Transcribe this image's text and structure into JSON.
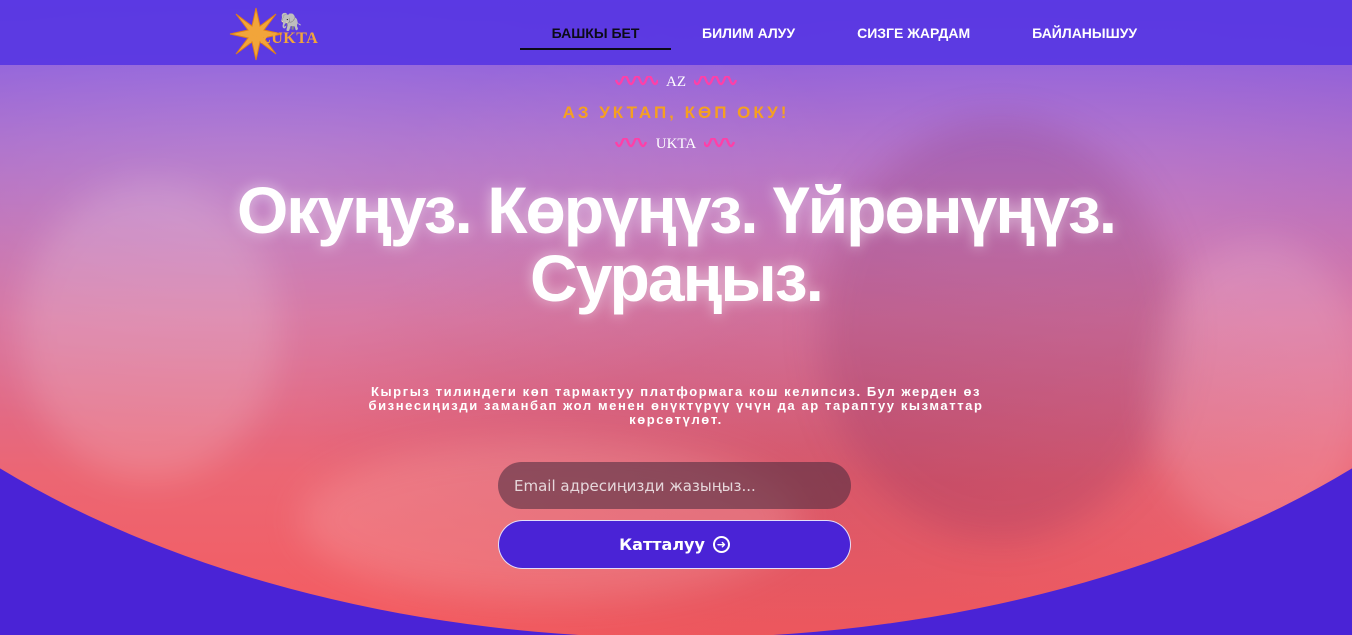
{
  "header": {
    "logo": {
      "brand_text": "AZUKTA",
      "icon": "sun-elephant-logo"
    },
    "nav": [
      {
        "label": "БАШКЫ БЕТ",
        "active": true
      },
      {
        "label": "БИЛИМ АЛУУ",
        "active": false
      },
      {
        "label": "СИЗГЕ ЖАРДАМ",
        "active": false
      },
      {
        "label": "БАЙЛАНЫШУУ",
        "active": false
      }
    ]
  },
  "hero": {
    "tag_top": "AZ",
    "tagline": "АЗ УКТАП, КӨП ОКУ!",
    "tag_bottom": "UKTA",
    "headline": "Окуңуз. Көрүңүз. Үйрөнүңүз. Сураңыз.",
    "subtext": "Кыргыз тилиндеги көп тармактуу платформага кош келипсиз.  Бул жерден өз бизнесиңизди заманбап жол менен өнүктүрүү үчүн да ар тараптуу кызматтар көрсөтүлөт.",
    "email_placeholder": "Email адресиңизди жазыңыз...",
    "signup_label": "Катталуу",
    "signup_icon": "arrow-circle-right-icon",
    "squiggle_icon": "wave-squiggle-icon"
  },
  "colors": {
    "brand_purple": "#4a23d6",
    "header_purple": "#5837e2",
    "accent_orange": "#f5a021",
    "squiggle_pink": "#ff3fa8",
    "logo_gold": "#f2a53a"
  }
}
